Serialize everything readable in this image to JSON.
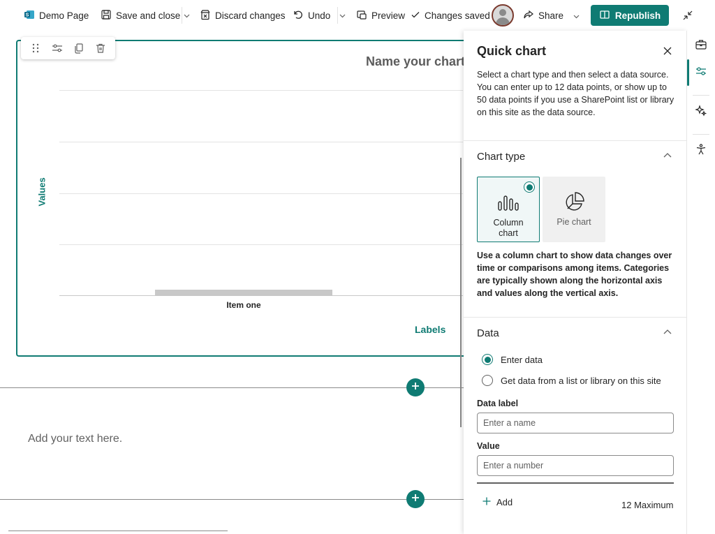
{
  "toolbar": {
    "page_name": "Demo Page",
    "save_close": "Save and close",
    "discard": "Discard changes",
    "undo": "Undo",
    "preview": "Preview",
    "changes_saved": "Changes saved",
    "share": "Share",
    "republish": "Republish"
  },
  "chart": {
    "y_axis_label": "Values",
    "x_axis_label": "Labels",
    "title_placeholder": "Name your chart"
  },
  "chart_data": {
    "type": "bar",
    "title": "",
    "categories": [
      "Item one"
    ],
    "values": [
      0
    ],
    "xlabel": "Labels",
    "ylabel": "Values",
    "grid": true
  },
  "canvas": {
    "text_placeholder": "Add your text here."
  },
  "pane": {
    "title": "Quick chart",
    "description": "Select a chart type and then select a data source. You can enter up to 12 data points, or show up to 50 data points if you use a SharePoint list or library on this site as the data source.",
    "chart_type_header": "Chart type",
    "chart_types": [
      {
        "label": "Column chart",
        "selected": true
      },
      {
        "label": "Pie chart",
        "selected": false
      }
    ],
    "chart_type_help": "Use a column chart to show data changes over time or comparisons among items. Categories are typically shown along the horizontal axis and values along the vertical axis.",
    "data_header": "Data",
    "data_sources": [
      {
        "label": "Enter data",
        "selected": true
      },
      {
        "label": "Get data from a list or library on this site",
        "selected": false
      }
    ],
    "data_label_title": "Data label",
    "data_label_placeholder": "Enter a name",
    "value_title": "Value",
    "value_placeholder": "Enter a number",
    "add_label": "Add",
    "max_text": "12 Maximum"
  },
  "colors": {
    "accent": "#0f7b73",
    "bar": "#c8c8c8"
  }
}
